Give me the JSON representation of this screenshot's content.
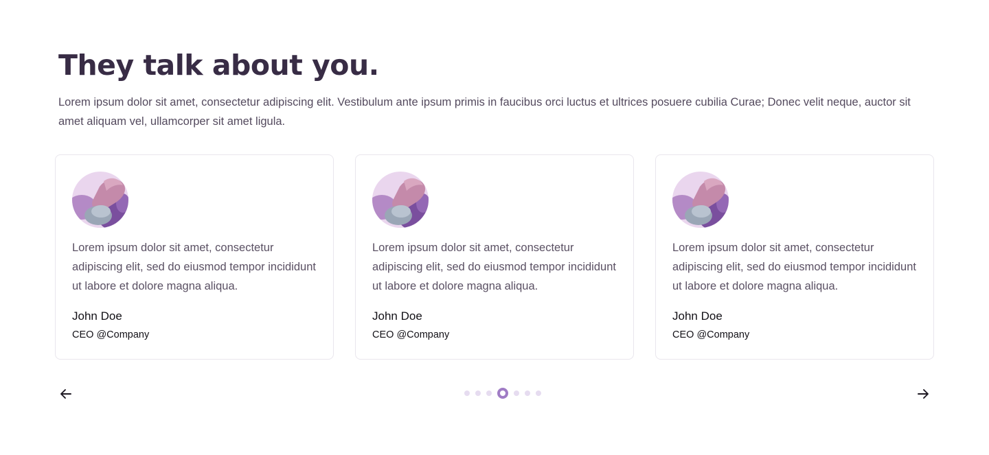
{
  "section": {
    "title": "They talk about you.",
    "description": "Lorem ipsum dolor sit amet, consectetur adipiscing elit. Vestibulum ante ipsum primis in faucibus orci luctus et ultrices posuere cubilia Curae; Donec velit neque, auctor sit amet aliquam vel, ullamcorper sit amet ligula."
  },
  "testimonials": [
    {
      "quote": "Lorem ipsum dolor sit amet, consectetur adipiscing elit, sed do eiusmod tempor incididunt ut labore et dolore magna aliqua.",
      "name": "John Doe",
      "role": "CEO @Company",
      "avatar_icon": "abstract-avatar"
    },
    {
      "quote": "Lorem ipsum dolor sit amet, consectetur adipiscing elit, sed do eiusmod tempor incididunt ut labore et dolore magna aliqua.",
      "name": "John Doe",
      "role": "CEO @Company",
      "avatar_icon": "abstract-avatar"
    },
    {
      "quote": "Lorem ipsum dolor sit amet, consectetur adipiscing elit, sed do eiusmod tempor incididunt ut labore et dolore magna aliqua.",
      "name": "John Doe",
      "role": "CEO @Company",
      "avatar_icon": "abstract-avatar"
    }
  ],
  "carousel": {
    "prev_icon": "arrow-left-icon",
    "next_icon": "arrow-right-icon",
    "dot_count": 7,
    "active_dot": 4
  },
  "colors": {
    "heading": "#382c45",
    "accent": "#a07cc5",
    "dot_inactive": "#e6dcf0",
    "card_border": "#e9e6ed"
  }
}
